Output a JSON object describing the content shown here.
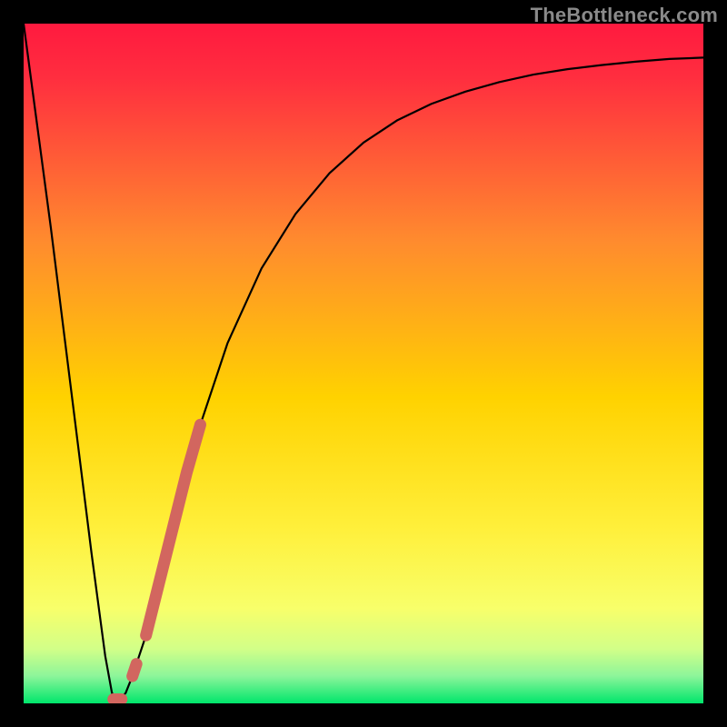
{
  "watermark": "TheBottleneck.com",
  "chart_data": {
    "type": "line",
    "title": "",
    "xlabel": "",
    "ylabel": "",
    "xlim": [
      0,
      100
    ],
    "ylim": [
      0,
      100
    ],
    "grid": false,
    "legend": false,
    "background_gradient_top": "#ff1a3f",
    "background_gradient_mid": "#ffd200",
    "background_gradient_bottom": "#00e66b",
    "series": [
      {
        "name": "bottleneck-curve",
        "color": "#000000",
        "x": [
          0,
          2,
          4,
          6,
          8,
          10,
          12,
          13,
          14,
          15,
          16,
          18,
          20,
          22,
          24,
          26,
          30,
          35,
          40,
          45,
          50,
          55,
          60,
          65,
          70,
          75,
          80,
          85,
          90,
          95,
          100
        ],
        "y": [
          100,
          85,
          70,
          54,
          38,
          22,
          7,
          1.5,
          0.5,
          1.5,
          4,
          10,
          18,
          26,
          34,
          41,
          53,
          64,
          72,
          78,
          82.5,
          85.8,
          88.2,
          90,
          91.4,
          92.5,
          93.3,
          93.9,
          94.4,
          94.8,
          95
        ]
      },
      {
        "name": "highlight-segment",
        "color": "#d2665f",
        "thick": true,
        "x": [
          18,
          19,
          20,
          21,
          22,
          23,
          24,
          25,
          26
        ],
        "y": [
          10,
          14,
          18,
          22,
          26,
          30,
          34,
          37.5,
          41
        ]
      },
      {
        "name": "highlight-dot-lower",
        "color": "#d2665f",
        "thick": true,
        "x": [
          16,
          16.6
        ],
        "y": [
          4,
          5.8
        ]
      },
      {
        "name": "highlight-dot-min",
        "color": "#d2665f",
        "thick": true,
        "x": [
          13.2,
          14.4
        ],
        "y": [
          0.6,
          0.6
        ]
      }
    ]
  }
}
